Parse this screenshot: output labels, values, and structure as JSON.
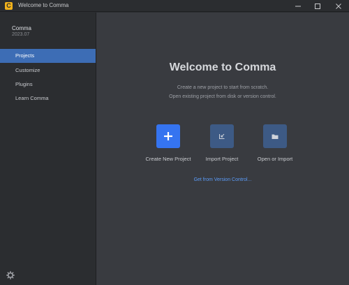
{
  "window": {
    "title": "Welcome to Comma",
    "app_icon_letter": "C"
  },
  "sidebar": {
    "product_name": "Comma",
    "product_version": "2023.07",
    "items": [
      {
        "label": "Projects",
        "active": true
      },
      {
        "label": "Customize",
        "active": false
      },
      {
        "label": "Plugins",
        "active": false
      },
      {
        "label": "Learn Comma",
        "active": false
      }
    ],
    "settings_icon": "gear-icon"
  },
  "main": {
    "headline": "Welcome to Comma",
    "subtitle_line1": "Create a new project to start from scratch.",
    "subtitle_line2": "Open existing project from disk or version control.",
    "actions": [
      {
        "label": "Create New Project",
        "icon": "plus-icon"
      },
      {
        "label": "Import Project",
        "icon": "import-icon"
      },
      {
        "label": "Open or Import",
        "icon": "folder-icon"
      }
    ],
    "vcs_link": "Get from Version Control..."
  },
  "colors": {
    "accent": "#3574f0",
    "sidebar_selected": "#3d6db5",
    "link": "#5b9bf7",
    "app_icon": "#f2b21b"
  }
}
